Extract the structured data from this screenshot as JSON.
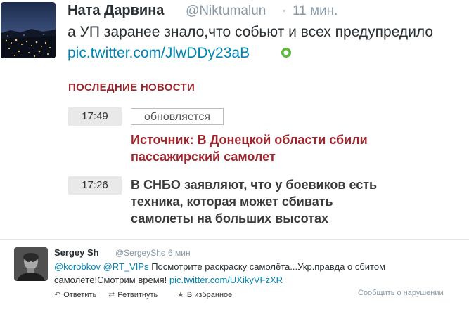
{
  "tweet1": {
    "name": "Ната Дарвина",
    "handle": "@Niktumalun",
    "separator": "·",
    "time": "11 мин.",
    "text": "а УП заранее знало,что собьют и всех предупредило",
    "link": "pic.twitter.com/JlwDDy23aB",
    "avatar_icon": "city-night-photo",
    "badge_icon": "green-circle-icon"
  },
  "news": {
    "header": "ПОСЛЕДНИЕ НОВОСТИ",
    "items": [
      {
        "time": "17:49",
        "badge": "обновляется",
        "title_lines": [
          "Источник: В Донецкой области сбили",
          "пассажирский самолет"
        ]
      },
      {
        "time": "17:26",
        "title_lines": [
          "В СНБО заявляют, что у боевиков есть",
          "техника, которая может сбивать",
          "самолеты на больших высотах"
        ]
      }
    ]
  },
  "tweet2": {
    "name": "Sergey Sh",
    "handle": "@SergeyShc",
    "separator": "·",
    "time": "6 мин",
    "mention1": "@korobkov",
    "mention2": "@RT_VIPs",
    "text1": "Посмотрите раскраску самолёта...Укр.правда о сбитом",
    "text2": "самолёте!Смотрим время!",
    "link": "pic.twitter.com/UXikyVFzXR",
    "avatar_icon": "user-portrait",
    "actions": {
      "reply": "Ответить",
      "retweet": "Ретвитнуть",
      "favorite": "В избранное"
    },
    "report": "Сообщить о нарушении"
  },
  "colors": {
    "link": "#0084b4",
    "news_red": "#a0262e",
    "muted": "#8899a6",
    "text": "#292f33"
  }
}
